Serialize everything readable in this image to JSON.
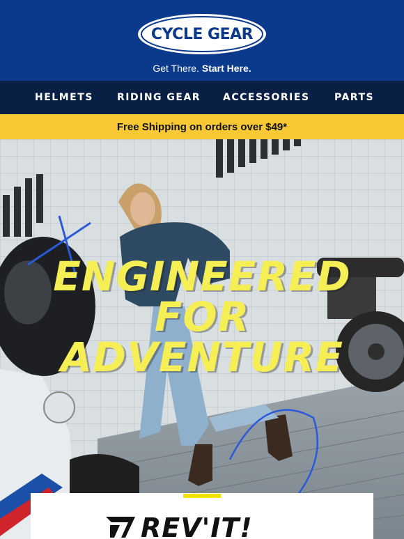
{
  "header": {
    "logo_text": "CYCLE GEAR",
    "tagline_regular": "Get There.",
    "tagline_bold": "Start Here."
  },
  "nav": {
    "items": [
      {
        "label": "HELMETS"
      },
      {
        "label": "RIDING GEAR"
      },
      {
        "label": "ACCESSORIES"
      },
      {
        "label": "PARTS"
      }
    ]
  },
  "promo": {
    "shipping": "Free Shipping on orders over $49*"
  },
  "hero": {
    "headline_line1": "ENGINEERED",
    "headline_line2": "FOR",
    "headline_line3": "ADVENTURE"
  },
  "brand_card": {
    "brand_name": "REV'IT!"
  },
  "colors": {
    "header_bg": "#0b3a8d",
    "nav_bg": "#0a1f44",
    "promo_bg": "#f7c833",
    "headline": "#f5ee55",
    "accent": "#f2e200"
  },
  "icons": {
    "logo": "cycle-gear-oval-logo",
    "brand_mark": "revit-logo-mark"
  }
}
